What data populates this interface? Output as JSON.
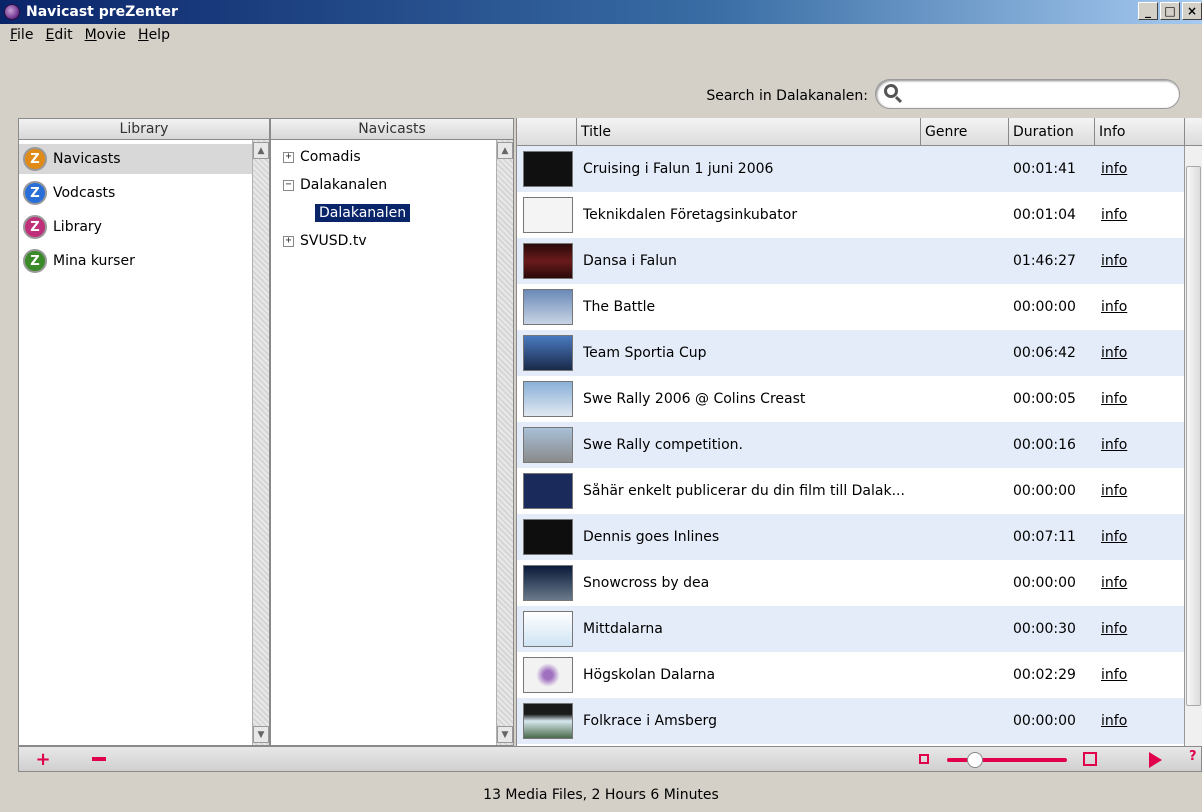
{
  "window": {
    "title": "Navicast preZenter"
  },
  "menu": [
    {
      "label": "File",
      "key": "F",
      "rest": "ile"
    },
    {
      "label": "Edit",
      "key": "E",
      "rest": "dit"
    },
    {
      "label": "Movie",
      "key": "M",
      "rest": "ovie"
    },
    {
      "label": "Help",
      "key": "H",
      "rest": "elp"
    }
  ],
  "search": {
    "label": "Search in Dalakanalen:",
    "value": ""
  },
  "library": {
    "header": "Library",
    "items": [
      {
        "label": "Navicasts",
        "icon": "navicast-icon",
        "color": "#e08a18"
      },
      {
        "label": "Vodcasts",
        "icon": "vodcast-icon",
        "color": "#2a6fd8"
      },
      {
        "label": "Library",
        "icon": "library-icon",
        "color": "#c0307a"
      },
      {
        "label": "Mina kurser",
        "icon": "kurser-icon",
        "color": "#3a8a2a"
      }
    ]
  },
  "navicasts": {
    "header": "Navicasts",
    "tree": [
      {
        "label": "Comadis",
        "toggle": "+"
      },
      {
        "label": "Dalakanalen",
        "toggle": "−"
      },
      {
        "label": "Dalakanalen",
        "child": true,
        "selected": true
      },
      {
        "label": "SVUSD.tv",
        "toggle": "+"
      }
    ]
  },
  "table": {
    "columns": [
      "Title",
      "Genre",
      "Duration",
      "Info"
    ],
    "rows": [
      {
        "title": "Cruising i Falun 1 juni 2006",
        "duration": "00:01:41",
        "info": "info"
      },
      {
        "title": "Teknikdalen Företagsinkubator",
        "duration": "00:01:04",
        "info": "info"
      },
      {
        "title": "Dansa i Falun",
        "duration": "01:46:27",
        "info": "info"
      },
      {
        "title": "The Battle",
        "duration": "00:00:00",
        "info": "info"
      },
      {
        "title": "Team Sportia Cup",
        "duration": "00:06:42",
        "info": "info"
      },
      {
        "title": "Swe Rally 2006 @ Colins Creast",
        "duration": "00:00:05",
        "info": "info"
      },
      {
        "title": "Swe Rally competition.",
        "duration": "00:00:16",
        "info": "info"
      },
      {
        "title": "Såhär enkelt publicerar du din film till Dalak...",
        "duration": "00:00:00",
        "info": "info"
      },
      {
        "title": "Dennis goes Inlines",
        "duration": "00:07:11",
        "info": "info"
      },
      {
        "title": "Snowcross by dea",
        "duration": "00:00:00",
        "info": "info"
      },
      {
        "title": "Mittdalarna",
        "duration": "00:00:30",
        "info": "info"
      },
      {
        "title": "Högskolan Dalarna",
        "duration": "00:02:29",
        "info": "info"
      },
      {
        "title": "Folkrace i Amsberg",
        "duration": "00:00:00",
        "info": "info"
      }
    ]
  },
  "status": {
    "text": "13 Media Files, 2 Hours 6 Minutes"
  },
  "colors": {
    "accent": "#e0004d",
    "selection": "#0a246a",
    "row_alt": "#e5ecf9"
  }
}
